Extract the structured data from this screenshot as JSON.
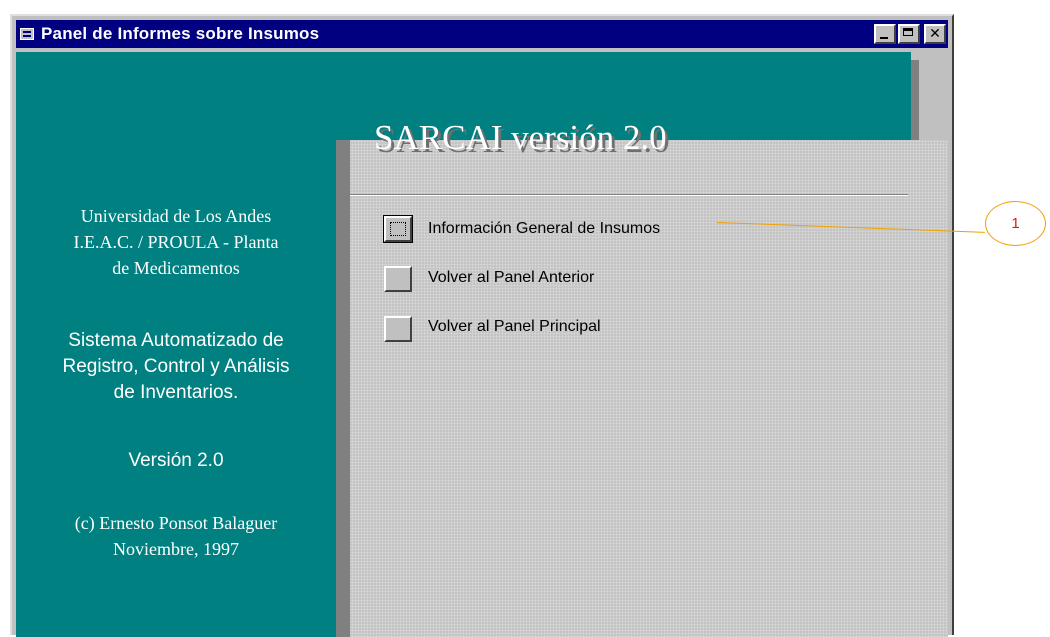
{
  "window": {
    "title": "Panel de Informes sobre Insumos",
    "controls": {
      "minimize": "",
      "maximize": "",
      "close": "✕"
    }
  },
  "header": {
    "app_title": "SARCAI versión 2.0"
  },
  "info": {
    "institution": [
      "Universidad de Los Andes",
      "I.E.A.C. / PROULA - Planta",
      "de Medicamentos"
    ],
    "system": [
      "Sistema Automatizado de",
      "Registro, Control y Análisis",
      "de Inventarios."
    ],
    "version": "Versión 2.0",
    "copyright": [
      "(c) Ernesto Ponsot Balaguer",
      "Noviembre, 1997"
    ]
  },
  "menu": {
    "items": [
      {
        "label": "Información General de Insumos"
      },
      {
        "label": "Volver al Panel Anterior"
      },
      {
        "label": "Volver al Panel Principal"
      }
    ]
  },
  "callout": {
    "number": "1",
    "color": "#f0a000",
    "text_color": "#e31d00"
  },
  "colors": {
    "titlebar": "#000080",
    "teal": "#008080",
    "window": "#c0c0c0"
  }
}
